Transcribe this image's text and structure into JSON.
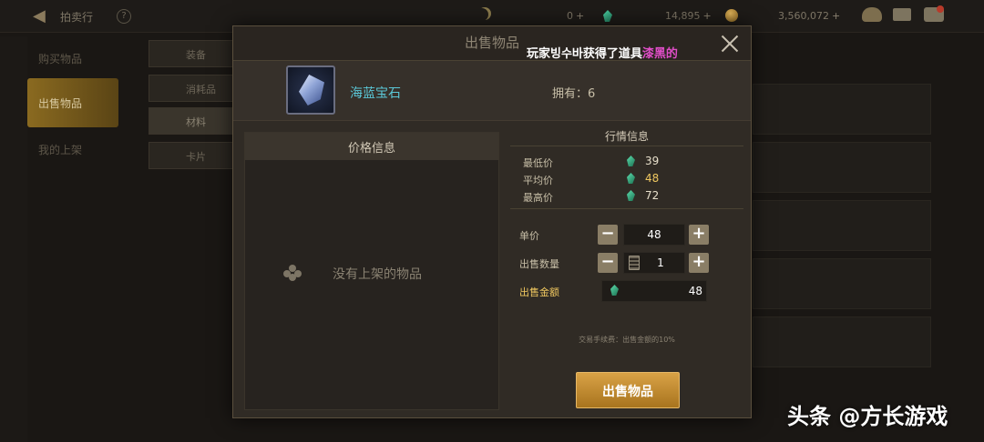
{
  "topbar": {
    "title": "拍卖行",
    "currency_moon": "0",
    "currency_gem": "14,895",
    "currency_gold": "3,560,072",
    "plus": "+"
  },
  "leftnav": {
    "items": [
      {
        "label": "购买物品"
      },
      {
        "label": "出售物品"
      },
      {
        "label": "我的上架"
      }
    ]
  },
  "categories": [
    {
      "label": "装备"
    },
    {
      "label": "消耗品"
    },
    {
      "label": "材料"
    },
    {
      "label": "卡片"
    }
  ],
  "dialog": {
    "title": "出售物品",
    "notice_prefix": "玩家빙수바获得了道具",
    "notice_item": "漆黑的",
    "item_name": "海蓝宝石",
    "item_own": "拥有：6",
    "price_info_title": "价格信息",
    "empty_text": "没有上架的物品",
    "market_title": "行情信息",
    "market_rows": [
      {
        "label": "最低价",
        "value": "39"
      },
      {
        "label": "平均价",
        "value": "48"
      },
      {
        "label": "最高价",
        "value": "72"
      }
    ],
    "unit_price_label": "单价",
    "unit_price_value": "48",
    "quantity_label": "出售数量",
    "quantity_value": "1",
    "total_label": "出售金额",
    "total_value": "48",
    "fee_text": "交易手续费：出售金额的10%",
    "sell_button": "出售物品",
    "minus": "−",
    "plus": "+"
  },
  "watermark": "头条 @方长游戏",
  "colors": {
    "accent_gold": "#f0c860",
    "item_name": "#5bc8d8",
    "notice_highlight": "#e04ec8",
    "sell_button": "#c8902e"
  }
}
